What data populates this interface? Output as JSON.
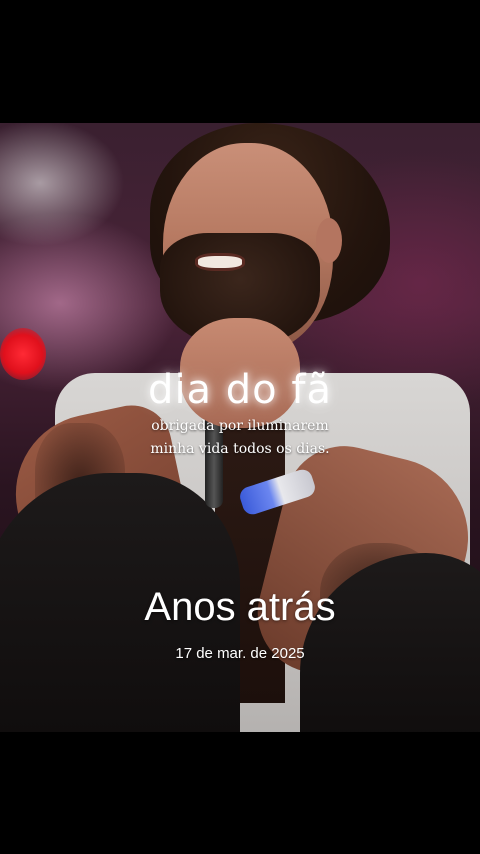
{
  "photo": {
    "subject": "singer-with-microphone",
    "accent_light_color": "#e0101c"
  },
  "overlay": {
    "title": "dia do fã",
    "line1": "obrigada por iluminarem",
    "line2": "minha vida todos os dias."
  },
  "memory": {
    "label": "Anos atrás",
    "date": "17 de mar. de 2025"
  }
}
